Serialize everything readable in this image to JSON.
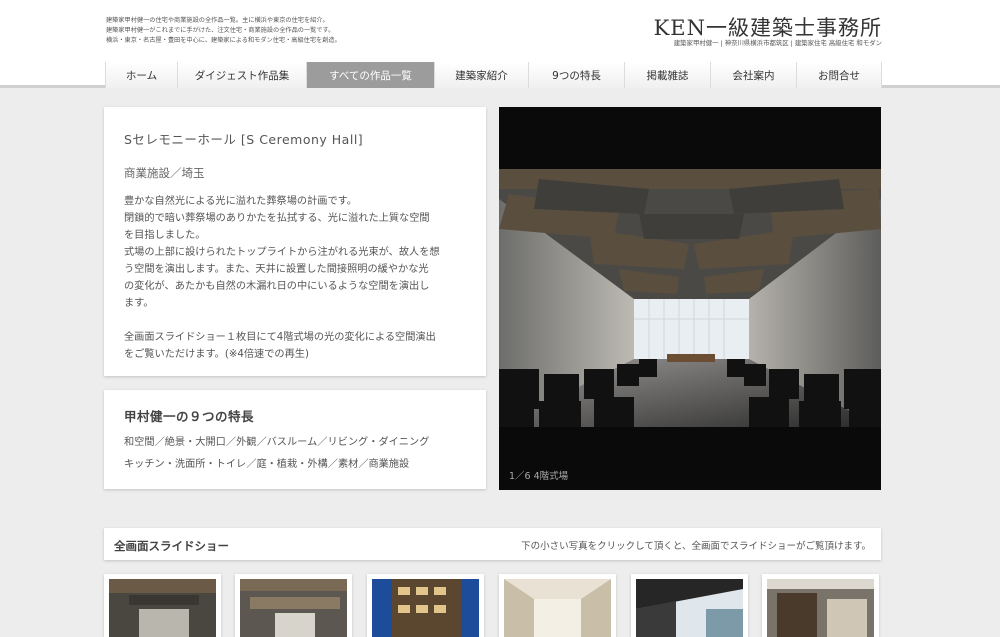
{
  "header": {
    "intro_lines": [
      "建築家甲村健一の住宅や商業施設の全作品一覧。主に横浜や東京の住宅を紹介。",
      "建築家甲村健一がこれまでに手がけた、注文住宅・商業施設の全作品の一覧です。",
      "横浜・東京・名古屋・豊田を中心に、建築家による和モダン住宅・高級住宅を創造。"
    ],
    "logo": "KEN一級建築士事務所",
    "logo_sub": "建築家甲村健一 | 神奈川県横浜市都筑区 | 建築家住宅 高級住宅 和モダン"
  },
  "nav": {
    "items": [
      {
        "label": "ホーム",
        "active": false
      },
      {
        "label": "ダイジェスト作品集",
        "active": false
      },
      {
        "label": "すべての作品一覧",
        "active": true
      },
      {
        "label": "建築家紹介",
        "active": false
      },
      {
        "label": "9つの特長",
        "active": false
      },
      {
        "label": "掲載雑誌",
        "active": false
      },
      {
        "label": "会社案内",
        "active": false
      },
      {
        "label": "お問合せ",
        "active": false
      }
    ]
  },
  "project": {
    "title": "Sセレモニーホール [S Ceremony Hall]",
    "category": "商業施設／埼玉",
    "description": [
      "豊かな自然光による光に溢れた葬祭場の計画です。",
      "閉鎖的で暗い葬祭場のありかたを払拭する、光に溢れた上質な空間",
      "を目指しました。",
      "式場の上部に設けられたトップライトから注がれる光束が、故人を想",
      "う空間を演出します。また、天井に設置した間接照明の緩やかな光",
      "の変化が、あたかも自然の木漏れ日の中にいるような空間を演出し",
      "ます。",
      "",
      "全画面スライドショー１枚目にて4階式場の光の変化による空間演出",
      "をご覧いただけます。(※4倍速での再生)"
    ]
  },
  "features": {
    "title": "甲村健一の９つの特長",
    "row1": [
      "和空間",
      "絶景・大開口",
      "外観",
      "バスルーム",
      "リビング・ダイニング"
    ],
    "row2": [
      "キッチン・洗面所・トイレ",
      "庭・植栽・外構",
      "素材",
      "商業施設"
    ],
    "separator": "／"
  },
  "photo": {
    "counter": "1／6",
    "caption": "4階式場"
  },
  "slideshow": {
    "title": "全画面スライドショー",
    "note": "下の小さい写真をクリックして頂くと、全画面でスライドショーがご覧頂けます。"
  },
  "colors": {
    "nav_active": "#9c9c9c",
    "page_bg": "#ededed"
  }
}
